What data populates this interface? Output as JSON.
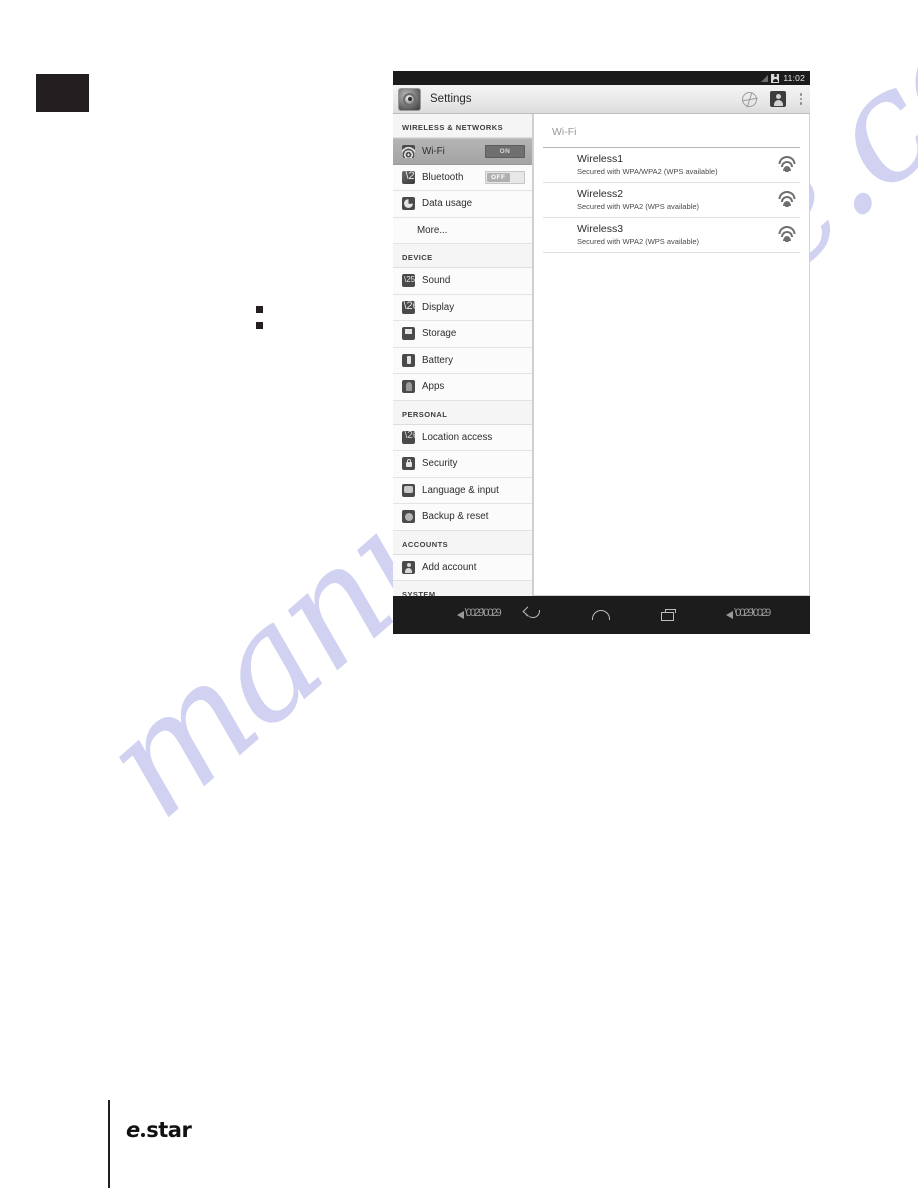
{
  "page": {
    "brand_e": "e",
    "brand_star": "star"
  },
  "device": {
    "statusbar": {
      "time": "11:02",
      "signal_icon": "signal-icon",
      "account_icon": "person-icon"
    },
    "actionbar": {
      "app_icon": "settings-gear-icon",
      "title": "Settings",
      "icons": [
        {
          "name": "globe-icon",
          "label": "Network"
        },
        {
          "name": "user-icon",
          "label": "User"
        },
        {
          "name": "overflow-menu-icon",
          "label": "More options"
        }
      ]
    },
    "sidebar": {
      "sections": [
        {
          "header": "WIRELESS & NETWORKS",
          "items": [
            {
              "label": "Wi-Fi",
              "icon": "wifi-icon",
              "selected": true,
              "toggle": "ON",
              "toggle_state": "on"
            },
            {
              "label": "Bluetooth",
              "icon": "bluetooth-icon",
              "selected": false,
              "toggle": "OFF",
              "toggle_state": "off"
            },
            {
              "label": "Data usage",
              "icon": "data-usage-icon",
              "selected": false
            },
            {
              "label": "More...",
              "icon": null,
              "selected": false
            }
          ]
        },
        {
          "header": "DEVICE",
          "items": [
            {
              "label": "Sound",
              "icon": "sound-icon",
              "selected": false
            },
            {
              "label": "Display",
              "icon": "display-icon",
              "selected": false
            },
            {
              "label": "Storage",
              "icon": "storage-icon",
              "selected": false
            },
            {
              "label": "Battery",
              "icon": "battery-icon",
              "selected": false
            },
            {
              "label": "Apps",
              "icon": "apps-icon",
              "selected": false
            }
          ]
        },
        {
          "header": "PERSONAL",
          "items": [
            {
              "label": "Location access",
              "icon": "location-icon",
              "selected": false
            },
            {
              "label": "Security",
              "icon": "lock-icon",
              "selected": false
            },
            {
              "label": "Language & input",
              "icon": "language-icon",
              "selected": false
            },
            {
              "label": "Backup & reset",
              "icon": "backup-icon",
              "selected": false
            }
          ]
        },
        {
          "header": "ACCOUNTS",
          "items": [
            {
              "label": "Add account",
              "icon": "account-icon",
              "selected": false
            }
          ]
        },
        {
          "header": "SYSTEM",
          "items": []
        }
      ]
    },
    "content": {
      "title": "Wi-Fi",
      "networks": [
        {
          "name": "Wireless1",
          "security": "Secured with WPA/WPA2 (WPS available)",
          "icon": "wifi-secured-icon"
        },
        {
          "name": "Wireless2",
          "security": "Secured with WPA2 (WPS available)",
          "icon": "wifi-secured-icon"
        },
        {
          "name": "Wireless3",
          "security": "Secured with WPA2 (WPS available)",
          "icon": "wifi-secured-icon"
        }
      ]
    },
    "navbar": {
      "buttons": [
        {
          "name": "volume-down-icon",
          "label": "Volume down"
        },
        {
          "name": "back-icon",
          "label": "Back"
        },
        {
          "name": "home-icon",
          "label": "Home"
        },
        {
          "name": "recents-icon",
          "label": "Recent apps"
        },
        {
          "name": "volume-up-icon",
          "label": "Volume up"
        }
      ]
    }
  },
  "watermark": {
    "text": "manualshive.com",
    "color": "#cfcff2"
  }
}
